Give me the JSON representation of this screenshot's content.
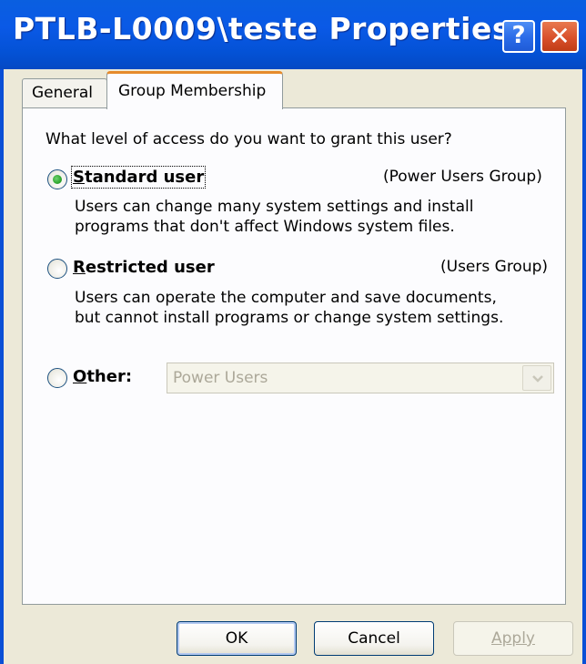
{
  "window": {
    "title": "PTLB-L0009\\teste Properties",
    "help_glyph": "?",
    "close_glyph": "✕"
  },
  "tabs": [
    {
      "label": "General",
      "active": false
    },
    {
      "label": "Group Membership",
      "active": true
    }
  ],
  "main": {
    "question": "What level of access do you want to grant this user?",
    "options": [
      {
        "label": "Standard user",
        "access_key": "S",
        "group": "(Power Users Group)",
        "description_lines": [
          "Users can change many system settings and install",
          "programs that don't affect Windows system files."
        ],
        "selected": true
      },
      {
        "label": "Restricted user",
        "access_key": "R",
        "group": "(Users Group)",
        "description_lines": [
          "Users can operate the computer and save documents,",
          "but cannot install programs or change system settings."
        ],
        "selected": false
      },
      {
        "label": "Other:",
        "access_key": "O",
        "selected": false
      }
    ],
    "other_select": {
      "value": "Power Users",
      "enabled": false
    }
  },
  "buttons": {
    "ok": "OK",
    "cancel": "Cancel",
    "apply": "Apply"
  },
  "colors": {
    "titlebar": "#0A59E6",
    "dialog_bg": "#ECE9D8",
    "panel_bg": "#FCFCFE",
    "tab_highlight": "#E68B2C",
    "radio_check": "#2FA62F",
    "disabled_text": "#ACA899"
  },
  "icons": {
    "help": "help-question-icon",
    "close": "close-x-icon",
    "dropdown": "chevron-down-icon"
  }
}
